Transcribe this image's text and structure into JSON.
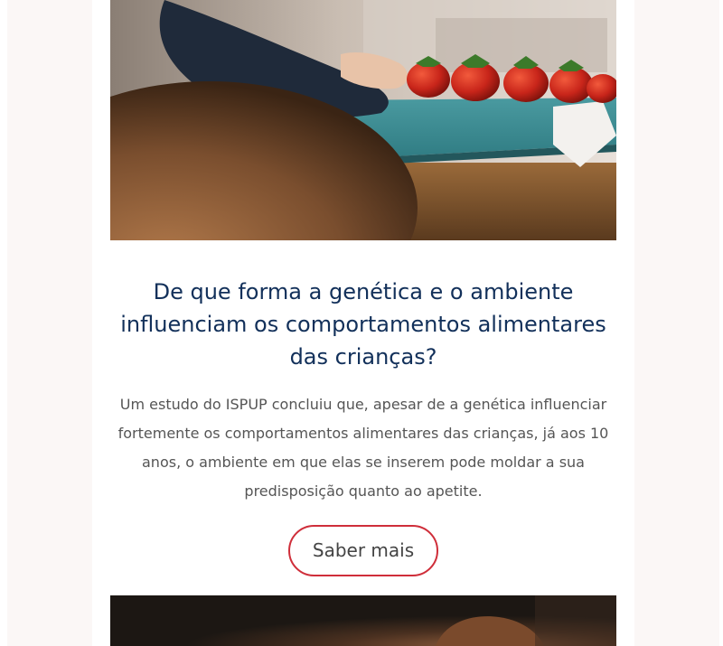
{
  "article": {
    "title": "De que forma a genética e o ambiente influenciam os comportamentos alimentares das crianças?",
    "summary": "Um estudo do ISPUP concluiu que, apesar de a genética influenciar fortemente os comportamentos alimentares das crianças, já aos 10 anos, o ambiente em que elas se inserem pode moldar a sua predisposição quanto ao apetite.",
    "cta_label": "Saber mais"
  },
  "images": {
    "hero": "child-reaching-strawberries-photo",
    "next": "child-portrait-photo"
  },
  "colors": {
    "title": "#12305a",
    "text": "#555555",
    "button_border": "#cf2e3a",
    "page_background": "#fbf7f6"
  }
}
